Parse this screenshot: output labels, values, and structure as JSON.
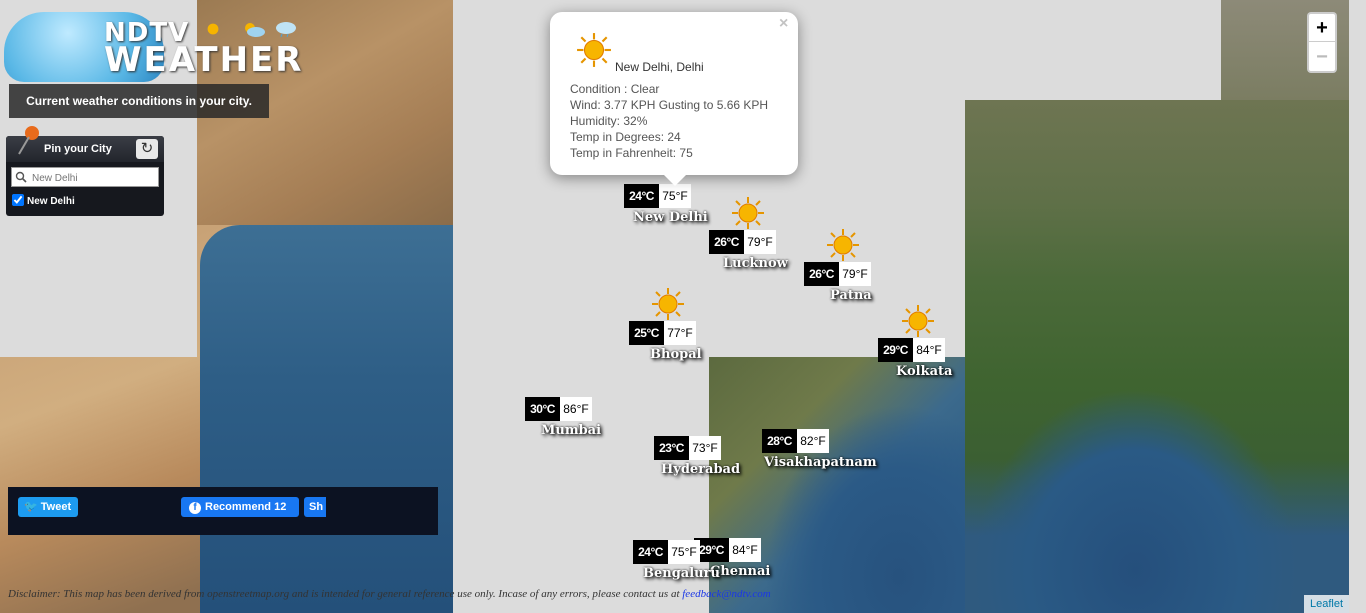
{
  "header": {
    "brand_top": "NDTV",
    "brand_bottom": "WEATHER",
    "tagline": "Current weather conditions in your city."
  },
  "pin_panel": {
    "title": "Pin your City",
    "search_placeholder": "New Delhi",
    "checked_city": "New Delhi",
    "refresh_icon": "refresh-icon",
    "pin_icon": "pushpin-icon"
  },
  "social": {
    "tweet_label": "Tweet",
    "recommend_label": "Recommend 12",
    "share_label": "Sh"
  },
  "zoom": {
    "in_label": "+",
    "out_label": "−"
  },
  "popup": {
    "city": "New Delhi, Delhi",
    "condition": "Condition : Clear",
    "wind": "Wind: 3.77 KPH Gusting to 5.66 KPH",
    "humidity": "Humidity: 32%",
    "temp_c": "Temp in Degrees: 24",
    "temp_f": "Temp in Fahrenheit: 75",
    "close_label": "×",
    "icon": "sun-icon"
  },
  "markers": [
    {
      "city": "New Delhi",
      "c": "24°C",
      "f": "75°F"
    },
    {
      "city": "Lucknow",
      "c": "26°C",
      "f": "79°F"
    },
    {
      "city": "Patna",
      "c": "26°C",
      "f": "79°F"
    },
    {
      "city": "Bhopal",
      "c": "25°C",
      "f": "77°F"
    },
    {
      "city": "Kolkata",
      "c": "29°C",
      "f": "84°F"
    },
    {
      "city": "Mumbai",
      "c": "30°C",
      "f": "86°F"
    },
    {
      "city": "Hyderabad",
      "c": "23°C",
      "f": "73°F"
    },
    {
      "city": "Visakhapatnam",
      "c": "28°C",
      "f": "82°F"
    },
    {
      "city": "Bengaluru",
      "c": "24°C",
      "f": "75°F"
    },
    {
      "city": "Chennai",
      "c": "29°C",
      "f": "84°F"
    }
  ],
  "footer": {
    "disclaimer": "Disclaimer: This map has been derived from openstreetmap.org and is intended for general reference use only. Incase of any errors, please contact us at",
    "feedback_email": "feedback@ndtv.com",
    "attribution": "Leaflet"
  }
}
